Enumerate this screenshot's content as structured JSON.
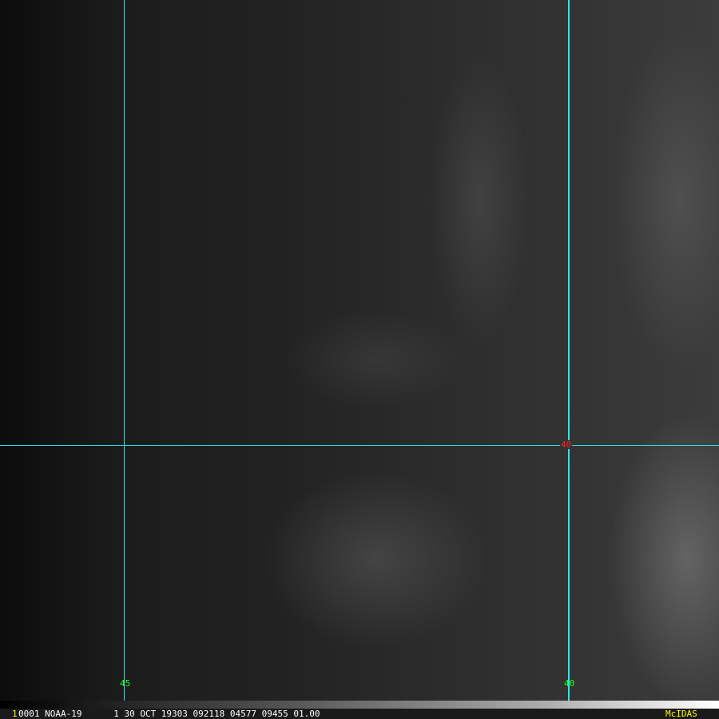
{
  "image": {
    "description_type": "satellite-visible-imagery"
  },
  "grid": {
    "lat_label": "40",
    "lon_labels": [
      "45",
      "40"
    ],
    "line_color": "#2ee6e6",
    "lat_label_color": "#ff0000",
    "lon_label_color": "#00ff00"
  },
  "infobar": {
    "frame": "1",
    "text": "0001 NOAA-19      1 30 OCT 19303 092118 04577 09455 01.00",
    "logo": "McIDAS"
  }
}
